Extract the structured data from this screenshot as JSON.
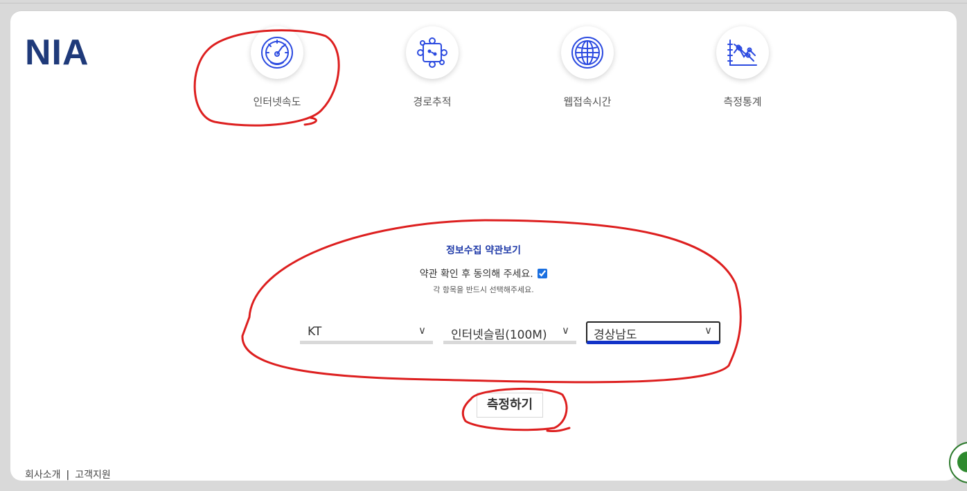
{
  "logo": {
    "text": "NIA"
  },
  "nav": {
    "items": [
      {
        "label": "인터넷속도",
        "icon": "speedometer-icon"
      },
      {
        "label": "경로추적",
        "icon": "route-trace-icon"
      },
      {
        "label": "웹접속시간",
        "icon": "globe-icon"
      },
      {
        "label": "측정통계",
        "icon": "statistics-icon"
      }
    ]
  },
  "terms": {
    "link_label": "정보수집 약관보기",
    "agree_label": "약관 확인 후 동의해 주세요.",
    "agree_checked": true,
    "notice": "각 항목을 반드시 선택해주세요."
  },
  "selects": {
    "isp": {
      "value": "KT"
    },
    "plan": {
      "value": "인터넷슬림(100M)"
    },
    "region": {
      "value": "경상남도"
    }
  },
  "measure": {
    "label": "측정하기"
  },
  "footer": {
    "company": "회사소개",
    "separator": "|",
    "support": "고객지원"
  },
  "colors": {
    "logo": "#1f3a7a",
    "accent": "#1233c8",
    "icon": "#2b4ae0",
    "annotation": "#dd1f1f"
  }
}
